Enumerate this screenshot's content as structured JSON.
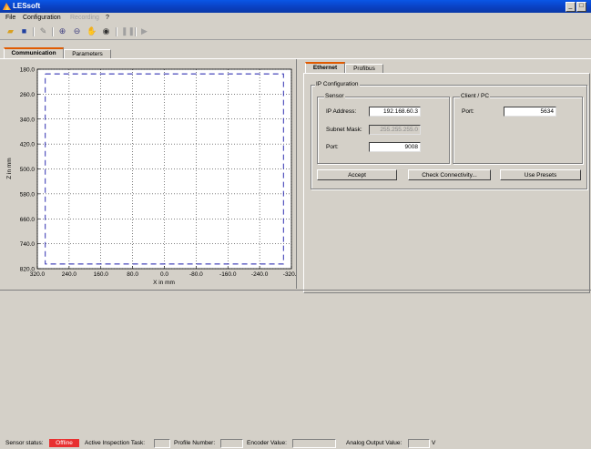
{
  "window": {
    "title": "LESsoft",
    "minimize": "_",
    "maximize": "□"
  },
  "menu": [
    "File",
    "Configuration",
    "Recording",
    "?"
  ],
  "toolbar_icons": [
    "open-folder-icon",
    "save-icon",
    "edit-icon",
    "zoom-in-icon",
    "zoom-out-icon",
    "pan-hand-icon",
    "reset-icon",
    "pause-icon",
    "play-icon"
  ],
  "main_tabs": [
    "Communication",
    "Parameters"
  ],
  "plot": {
    "ylabel": "Z in mm",
    "xlabel": "X in mm",
    "yticks": [
      "180.0",
      "260.0",
      "340.0",
      "420.0",
      "500.0",
      "580.0",
      "660.0",
      "740.0",
      "820.0"
    ],
    "xticks": [
      "320.0",
      "240.0",
      "160.0",
      "80.0",
      "0.0",
      "-80.0",
      "-160.0",
      "-240.0",
      "-320.0"
    ]
  },
  "chart_data": {
    "type": "line",
    "title": "",
    "xlabel": "X in mm",
    "ylabel": "Z in mm",
    "xlim": [
      320,
      -320
    ],
    "ylim": [
      180,
      820
    ],
    "y_inverted": true,
    "grid": true,
    "series": [
      {
        "x": [
          300,
          -300,
          -300,
          300,
          300
        ],
        "y": [
          195,
          195,
          805,
          805,
          195
        ],
        "style": "dashed",
        "color": "#1a1aaa"
      }
    ]
  },
  "settings_tabs": [
    "Ethernet",
    "Profibus"
  ],
  "ip_config": {
    "title": "IP Configuration",
    "sensor": {
      "title": "Sensor",
      "ip_label": "IP Address:",
      "ip_value": "192.168.60.3",
      "mask_label": "Subnet Mask:",
      "mask_value": "255.255.255.0",
      "port_label": "Port:",
      "port_value": "9008"
    },
    "client": {
      "title": "Client / PC",
      "port_label": "Port:",
      "port_value": "5634"
    },
    "buttons": {
      "accept": "Accept",
      "check": "Check Connectivity...",
      "presets": "Use Presets"
    }
  },
  "status": {
    "sensor_label": "Sensor status:",
    "sensor_value": "Offline",
    "sensor_color": "#e83030",
    "task_label": "Active Inspection Task:",
    "profile_label": "Profile Number:",
    "encoder_label": "Encoder Value:",
    "analog_label": "Analog Output Value:",
    "analog_unit": "V"
  }
}
